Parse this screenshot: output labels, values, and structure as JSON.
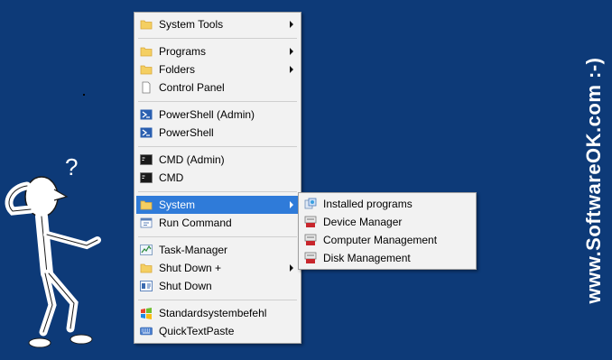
{
  "watermark": "www.SoftwareOK.com :-)",
  "figure_question_mark": "?",
  "main_menu": {
    "items": [
      {
        "label": "System Tools",
        "icon": "folder-icon",
        "submenu": true
      },
      {
        "label": "Programs",
        "icon": "folder-icon",
        "submenu": true
      },
      {
        "label": "Folders",
        "icon": "folder-icon",
        "submenu": true
      },
      {
        "label": "Control Panel",
        "icon": "document-icon",
        "submenu": false
      },
      {
        "label": "PowerShell (Admin)",
        "icon": "powershell-icon",
        "submenu": false
      },
      {
        "label": "PowerShell",
        "icon": "powershell-icon",
        "submenu": false
      },
      {
        "label": "CMD (Admin)",
        "icon": "cmd-icon",
        "submenu": false
      },
      {
        "label": "CMD",
        "icon": "cmd-icon",
        "submenu": false
      },
      {
        "label": "System",
        "icon": "folder-icon",
        "submenu": true,
        "highlighted": true
      },
      {
        "label": "Run Command",
        "icon": "run-icon",
        "submenu": false
      },
      {
        "label": "Task-Manager",
        "icon": "task-manager-icon",
        "submenu": false
      },
      {
        "label": "Shut Down +",
        "icon": "folder-icon",
        "submenu": true
      },
      {
        "label": "Shut Down",
        "icon": "shutdown-icon",
        "submenu": false
      },
      {
        "label": "Standardsystembefehl",
        "icon": "windows-logo-icon",
        "submenu": false
      },
      {
        "label": "QuickTextPaste",
        "icon": "keyboard-icon",
        "submenu": false
      }
    ]
  },
  "sub_menu": {
    "items": [
      {
        "label": "Installed programs",
        "icon": "installed-programs-icon"
      },
      {
        "label": "Device Manager",
        "icon": "device-manager-icon"
      },
      {
        "label": "Computer Management",
        "icon": "computer-management-icon"
      },
      {
        "label": "Disk Management",
        "icon": "disk-management-icon"
      }
    ]
  },
  "colors": {
    "background": "#0d3a78",
    "highlight": "#2f7bd9",
    "menu_bg": "#f2f2f2"
  }
}
